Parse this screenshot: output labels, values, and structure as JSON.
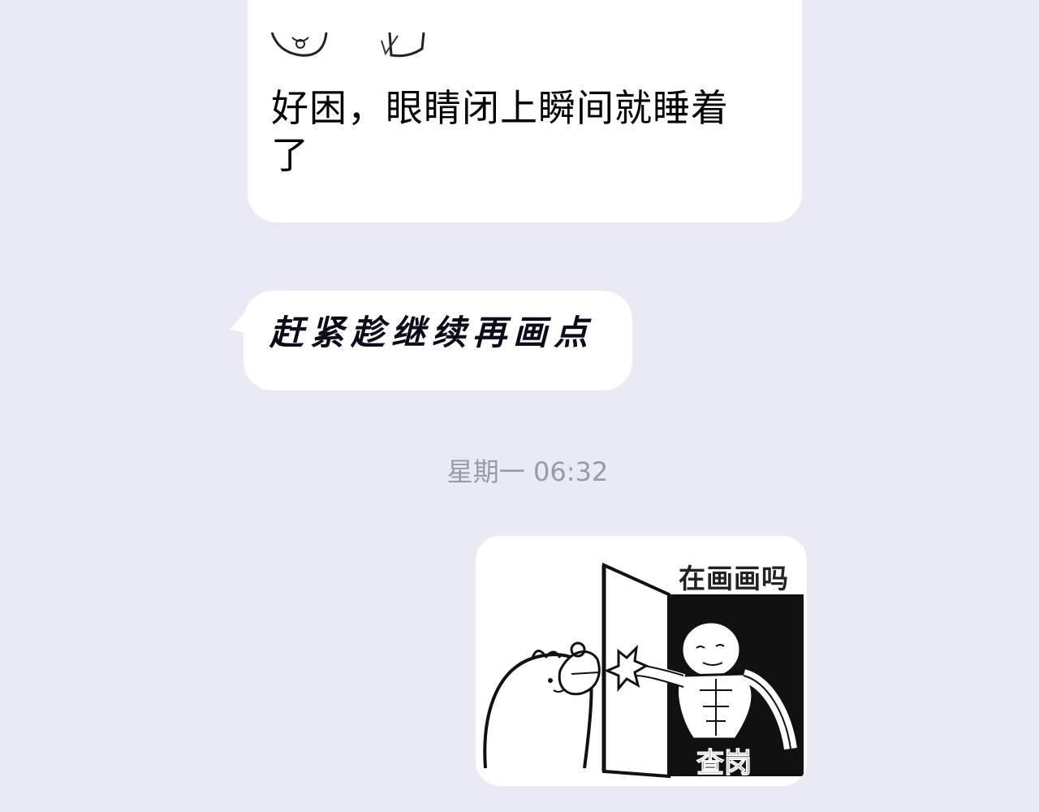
{
  "messages": [
    {
      "id": "msg1",
      "side": "left",
      "text": "好困，眼睛闭上瞬间就睡着了",
      "has_sticker_above": true
    },
    {
      "id": "msg2",
      "side": "left",
      "text": "赶紧趁继续再画点"
    }
  ],
  "timestamp": {
    "text": "星期一  06:32"
  },
  "sticker": {
    "side": "right",
    "caption_top": "在画画吗",
    "caption_bottom": "查岗"
  },
  "colors": {
    "background": "#e9eaf4",
    "bubble": "#ffffff",
    "timestamp": "#9a9aa5"
  }
}
